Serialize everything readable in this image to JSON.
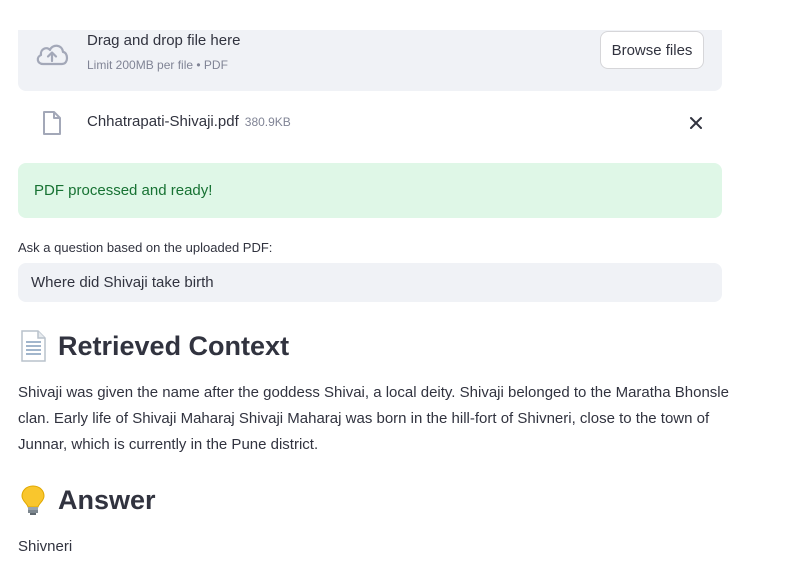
{
  "uploader": {
    "title": "Drag and drop file here",
    "subtitle": "Limit 200MB per file • PDF",
    "browse_label": "Browse files"
  },
  "file": {
    "name": "Chhatrapati-Shivaji.pdf",
    "size": "380.9KB"
  },
  "status": {
    "message": "PDF processed and ready!",
    "color": "#177233",
    "background": "#dff7e7"
  },
  "question": {
    "label": "Ask a question based on the uploaded PDF:",
    "value": "Where did Shivaji take birth"
  },
  "context": {
    "icon": "page-facing-up-icon",
    "heading": "Retrieved Context",
    "text": "Shivaji was given the name after the goddess Shivai, a local deity. Shivaji belonged to the Maratha Bhonsle clan. Early life of Shivaji Maharaj Shivaji Maharaj was born in the hill-fort of Shivneri, close to the town of Junnar, which is currently in the Pune district."
  },
  "answer": {
    "icon": "light-bulb-icon",
    "heading": "Answer",
    "text": "Shivneri"
  }
}
